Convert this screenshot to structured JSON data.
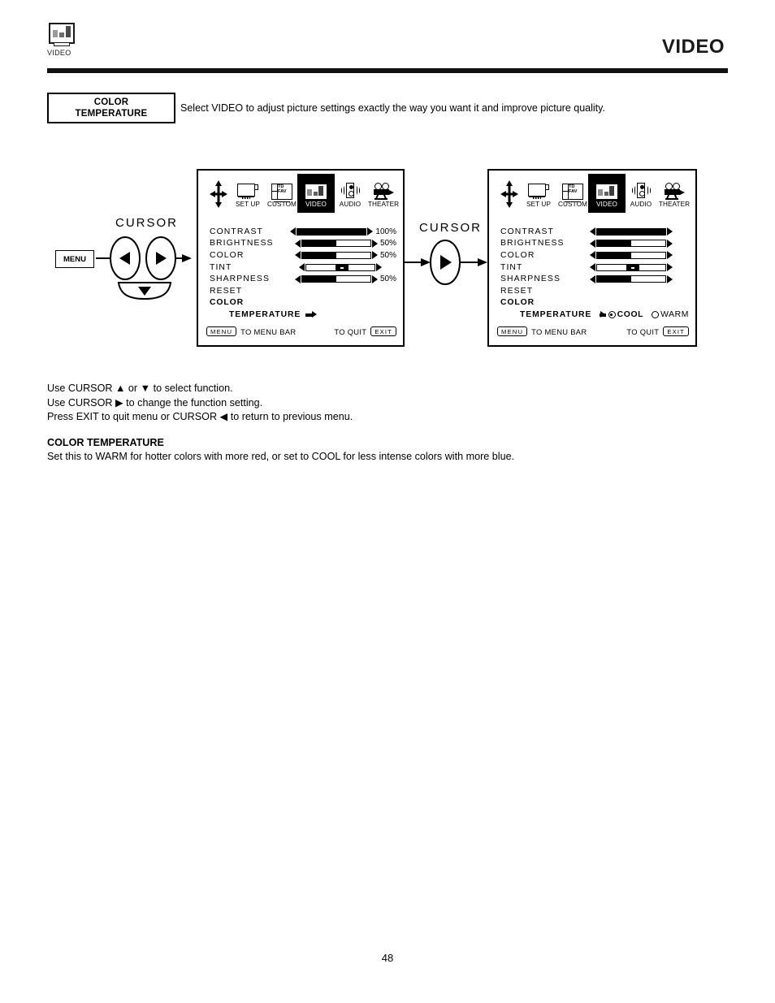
{
  "header": {
    "icon_name": "video-bars-icon",
    "icon_caption": "VIDEO",
    "title": "VIDEO"
  },
  "callout": {
    "line1": "COLOR",
    "line2": "TEMPERATURE",
    "description": "Select VIDEO to adjust picture settings exactly the way you want it and improve picture quality."
  },
  "remote": {
    "menu_button": "MENU",
    "cursor_label": "CURSOR"
  },
  "middle": {
    "cursor_label": "CURSOR"
  },
  "menu_icons": [
    {
      "name": "set-up-icon",
      "label": "SET UP",
      "selected": false
    },
    {
      "name": "custom-icon",
      "label": "CUSTOM",
      "selected": false,
      "glyph_text_1": "TD",
      "glyph_text_2": "FAV"
    },
    {
      "name": "video-icon",
      "label": "VIDEO",
      "selected": true
    },
    {
      "name": "audio-icon",
      "label": "AUDIO",
      "selected": false
    },
    {
      "name": "theater-icon",
      "label": "THEATER",
      "selected": false
    }
  ],
  "osd1": {
    "rows": [
      {
        "label": "CONTRAST",
        "fill_pct": 100,
        "value": "100%",
        "type": "bar"
      },
      {
        "label": "BRIGHTNESS",
        "fill_pct": 50,
        "value": "50%",
        "type": "bar"
      },
      {
        "label": "COLOR",
        "fill_pct": 50,
        "value": "50%",
        "type": "bar"
      },
      {
        "label": "TINT",
        "fill_pct": 0,
        "value": "",
        "type": "center"
      },
      {
        "label": "SHARPNESS",
        "fill_pct": 50,
        "value": "50%",
        "type": "bar"
      },
      {
        "label": "RESET",
        "value": "",
        "type": "plain"
      },
      {
        "label": "COLOR",
        "value": "",
        "type": "plain-bold"
      }
    ],
    "temperature_label": "TEMPERATURE",
    "footer_key_left": "MENU",
    "footer_text_left": "TO MENU BAR",
    "footer_text_right": "TO QUIT",
    "footer_key_right": "EXIT"
  },
  "osd2": {
    "rows": [
      {
        "label": "CONTRAST",
        "fill_pct": 100,
        "value": "",
        "type": "bar"
      },
      {
        "label": "BRIGHTNESS",
        "fill_pct": 50,
        "value": "",
        "type": "bar"
      },
      {
        "label": "COLOR",
        "fill_pct": 50,
        "value": "",
        "type": "bar"
      },
      {
        "label": "TINT",
        "fill_pct": 0,
        "value": "",
        "type": "center"
      },
      {
        "label": "SHARPNESS",
        "fill_pct": 50,
        "value": "",
        "type": "bar"
      },
      {
        "label": "RESET",
        "value": "",
        "type": "plain"
      },
      {
        "label": "COLOR",
        "value": "",
        "type": "plain-bold"
      }
    ],
    "temperature_label": "TEMPERATURE",
    "option_cool": "COOL",
    "option_warm": "WARM",
    "selected_option": "COOL",
    "footer_key_left": "MENU",
    "footer_text_left": "TO MENU BAR",
    "footer_text_right": "TO QUIT",
    "footer_key_right": "EXIT"
  },
  "instructions": {
    "line1": "Use CURSOR ▲ or ▼ to select function.",
    "line2": "Use CURSOR ▶ to change the function setting.",
    "line3": "Press EXIT to quit menu or CURSOR ◀ to return to previous menu."
  },
  "section": {
    "title": "COLOR TEMPERATURE",
    "body": "Set this to WARM for hotter colors with more red, or set to COOL for less intense colors with more blue."
  },
  "page_number": "48"
}
